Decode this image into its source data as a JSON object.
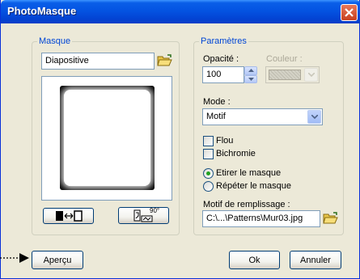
{
  "window": {
    "title": "PhotoMasque"
  },
  "masque": {
    "group_label": "Masque",
    "selected_mask": "Diapositive"
  },
  "parametres": {
    "group_label": "Paramètres",
    "opacity_label": "Opacité :",
    "opacity_value": "100",
    "color_label": "Couleur :",
    "mode_label": "Mode :",
    "mode_value": "Motif",
    "flou_label": "Flou",
    "flou_checked": false,
    "bichromie_label": "Bichromie",
    "bichromie_checked": false,
    "etirer_label": "Etirer le masque",
    "repeter_label": "Répéter le masque",
    "stretch_mode": "Etirer le masque",
    "motif_label": "Motif de remplissage :",
    "motif_value": "C:\\...\\Patterns\\Mur03.jpg"
  },
  "buttons": {
    "apercu": "Aperçu",
    "ok": "Ok",
    "annuler": "Annuler"
  },
  "icons": {
    "flip": "flip-horizontal-icon",
    "rotate": "rotate-90-icon",
    "rotate_label": "90°",
    "folder": "open-folder-icon",
    "close": "close-icon"
  }
}
